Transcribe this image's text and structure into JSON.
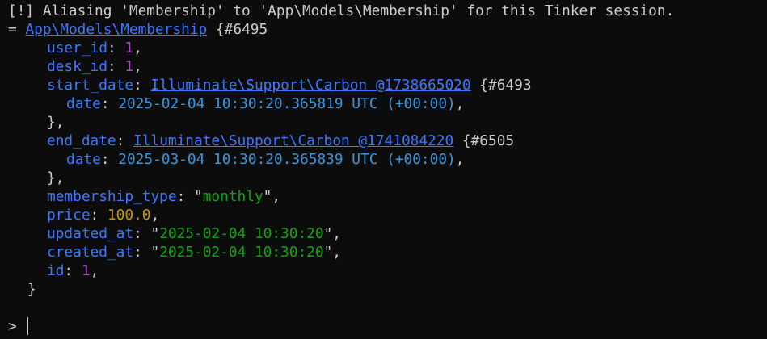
{
  "colors": {
    "background": "#0c0c0c",
    "text": "#cccccc",
    "key": "#3b78ff",
    "integer": "#b148c6",
    "string": "#13a10e",
    "float": "#c19c00",
    "date": "#3a96dd"
  },
  "terminal": {
    "notice": "[!] Aliasing 'Membership' to 'App\\Models\\Membership' for this Tinker session.",
    "result_prefix": "=",
    "model_class": "App\\Models\\Membership",
    "model_ref": "{#6495",
    "fields": {
      "user_id": {
        "key": "user_id",
        "value": "1"
      },
      "desk_id": {
        "key": "desk_id",
        "value": "1"
      },
      "start_date": {
        "key": "start_date",
        "class": "Illuminate\\Support\\Carbon @1738665020",
        "ref": "{#6493",
        "date_key": "date",
        "date_value": "2025-02-04 10:30:20.365819 UTC (+00:00)"
      },
      "end_date": {
        "key": "end_date",
        "class": "Illuminate\\Support\\Carbon @1741084220",
        "ref": "{#6505",
        "date_key": "date",
        "date_value": "2025-03-04 10:30:20.365839 UTC (+00:00)"
      },
      "membership_type": {
        "key": "membership_type",
        "value": "monthly"
      },
      "price": {
        "key": "price",
        "value": "100.0"
      },
      "updated_at": {
        "key": "updated_at",
        "value": "2025-02-04 10:30:20"
      },
      "created_at": {
        "key": "created_at",
        "value": "2025-02-04 10:30:20"
      },
      "id": {
        "key": "id",
        "value": "1"
      }
    },
    "closing_brace": "}",
    "prompt": ">"
  }
}
